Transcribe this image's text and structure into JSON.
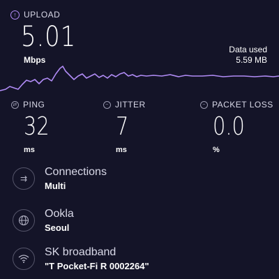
{
  "upload": {
    "label": "UPLOAD",
    "value": "5.01",
    "unit": "Mbps",
    "icon": "upload-arrow-icon",
    "accent_color": "#b18cf6"
  },
  "data_used": {
    "label": "Data used",
    "value": "5.59 MB"
  },
  "metrics": {
    "ping": {
      "label": "PING",
      "value": "32",
      "unit": "ms",
      "icon": "ping-icon"
    },
    "jitter": {
      "label": "JITTER",
      "value": "7",
      "unit": "ms",
      "icon": "jitter-icon"
    },
    "packet_loss": {
      "label": "PACKET LOSS",
      "value": "0.0",
      "unit": "%",
      "icon": "packet-loss-icon"
    }
  },
  "info": {
    "connections": {
      "title": "Connections",
      "value": "Multi",
      "icon": "connections-arrows-icon"
    },
    "server": {
      "title": "Ookla",
      "value": "Seoul",
      "icon": "globe-icon"
    },
    "provider": {
      "title": "SK broadband",
      "value": "\"T Pocket-Fi R 0002264\"",
      "icon": "wifi-icon"
    }
  },
  "colors": {
    "background": "#141428",
    "graph_line": "#b18cf6",
    "text_secondary": "#d9d9e8"
  }
}
